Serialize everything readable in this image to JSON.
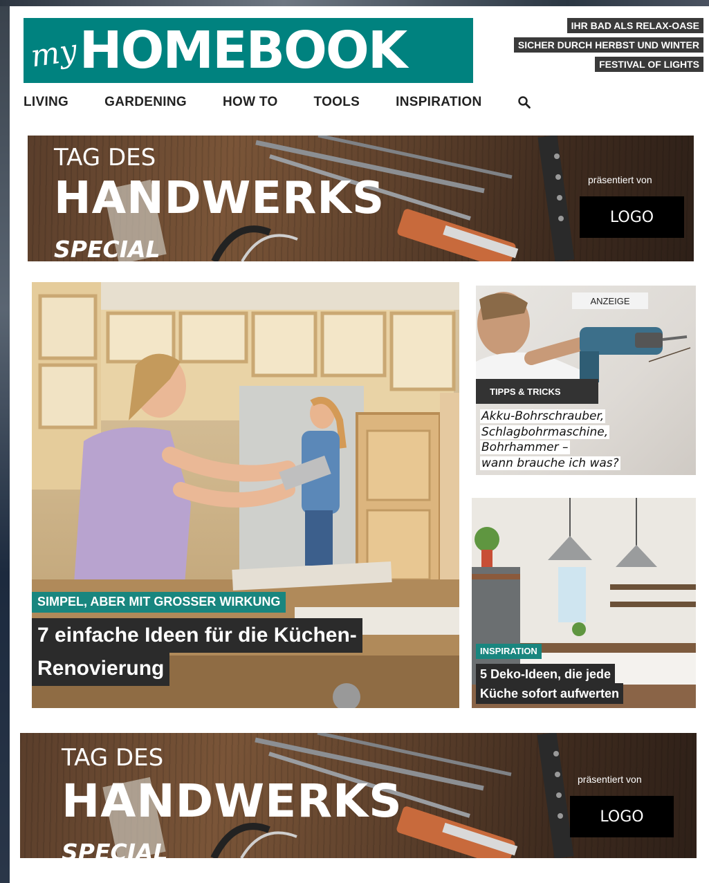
{
  "header": {
    "logo_prefix": "my",
    "logo_text": "HOMEBOOK",
    "promo_links": [
      {
        "label": "IHR BAD ALS RELAX-OASE"
      },
      {
        "label": "SICHER DURCH HERBST UND WINTER"
      },
      {
        "label": "FESTIVAL OF LIGHTS"
      }
    ],
    "nav": [
      {
        "label": "LIVING"
      },
      {
        "label": "GARDENING"
      },
      {
        "label": "HOW TO"
      },
      {
        "label": "TOOLS"
      },
      {
        "label": "INSPIRATION"
      }
    ],
    "search_icon": "search-icon"
  },
  "banner": {
    "subtitle": "TAG DES",
    "title": "HANDWERKS",
    "special": "SPECIAL",
    "presented_by": "präsentiert von",
    "logo_label": "LOGO"
  },
  "hero": {
    "kicker": "SIMPEL, ABER MIT GROSSER WIRKUNG",
    "headline_line1": "7 einfache Ideen für die Küchen-",
    "headline_line2": "Renovierung"
  },
  "card_drill": {
    "ad_label": "ANZEIGE",
    "category": "TIPPS & TRICKS",
    "title_lines": [
      "Akku-Bohrschrauber,",
      "Schlagbohrmaschine,",
      "Bohrhammer –",
      "wann brauche ich was?"
    ]
  },
  "card_kitchen": {
    "category": "INSPIRATION",
    "headline_line1": "5 Deko-Ideen, die jede",
    "headline_line2": "Küche sofort aufwerten"
  },
  "colors": {
    "brand_teal": "#00827f",
    "tag_teal": "#19867f",
    "dark": "#2b2b2b"
  }
}
